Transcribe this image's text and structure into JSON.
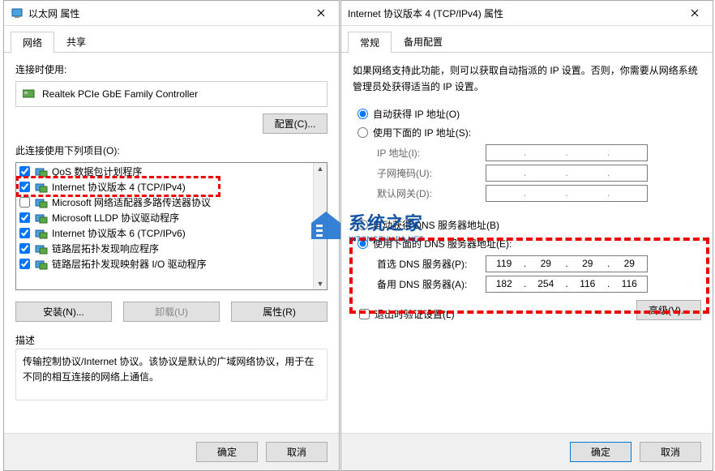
{
  "left": {
    "title": "以太网 属性",
    "tabs": [
      "网络",
      "共享"
    ],
    "active_tab": 0,
    "connect_using_label": "连接时使用:",
    "adapter": "Realtek PCIe GbE Family Controller",
    "configure_btn": "配置(C)...",
    "items_label": "此连接使用下列项目(O):",
    "items": [
      {
        "checked": true,
        "label": "QoS 数据包计划程序"
      },
      {
        "checked": true,
        "label": "Internet 协议版本 4 (TCP/IPv4)",
        "highlighted": true
      },
      {
        "checked": false,
        "label": "Microsoft 网络适配器多路传送器协议"
      },
      {
        "checked": true,
        "label": "Microsoft LLDP 协议驱动程序"
      },
      {
        "checked": true,
        "label": "Internet 协议版本 6 (TCP/IPv6)"
      },
      {
        "checked": true,
        "label": "链路层拓扑发现响应程序"
      },
      {
        "checked": true,
        "label": "链路层拓扑发现映射器 I/O 驱动程序"
      }
    ],
    "install_btn": "安装(N)...",
    "uninstall_btn": "卸载(U)",
    "properties_btn": "属性(R)",
    "desc_label": "描述",
    "desc_text": "传输控制协议/Internet 协议。该协议是默认的广域网络协议，用于在不同的相互连接的网络上通信。",
    "ok_btn": "确定",
    "cancel_btn": "取消"
  },
  "right": {
    "title": "Internet 协议版本 4 (TCP/IPv4) 属性",
    "tabs": [
      "常规",
      "备用配置"
    ],
    "active_tab": 0,
    "info": "如果网络支持此功能，则可以获取自动指派的 IP 设置。否则，你需要从网络系统管理员处获得适当的 IP 设置。",
    "ip_auto_label": "自动获得 IP 地址(O)",
    "ip_manual_label": "使用下面的 IP 地址(S):",
    "ip_mode": "auto",
    "ip_fields": {
      "ip_label": "IP 地址(I):",
      "mask_label": "子网掩码(U):",
      "gateway_label": "默认网关(D):"
    },
    "dns_auto_label": "自动获得 DNS 服务器地址(B)",
    "dns_manual_label": "使用下面的 DNS 服务器地址(E):",
    "dns_mode": "manual",
    "dns_fields": {
      "preferred_label": "首选 DNS 服务器(P):",
      "alternate_label": "备用 DNS 服务器(A):",
      "preferred_value": [
        "119",
        "29",
        "29",
        "29"
      ],
      "alternate_value": [
        "182",
        "254",
        "116",
        "116"
      ]
    },
    "validate_label": "退出时验证设置(L)",
    "advanced_btn": "高级(V)...",
    "ok_btn": "确定",
    "cancel_btn": "取消"
  },
  "watermark": {
    "title": "系统之家",
    "sub": "XITONGZHUJIA.NET"
  }
}
